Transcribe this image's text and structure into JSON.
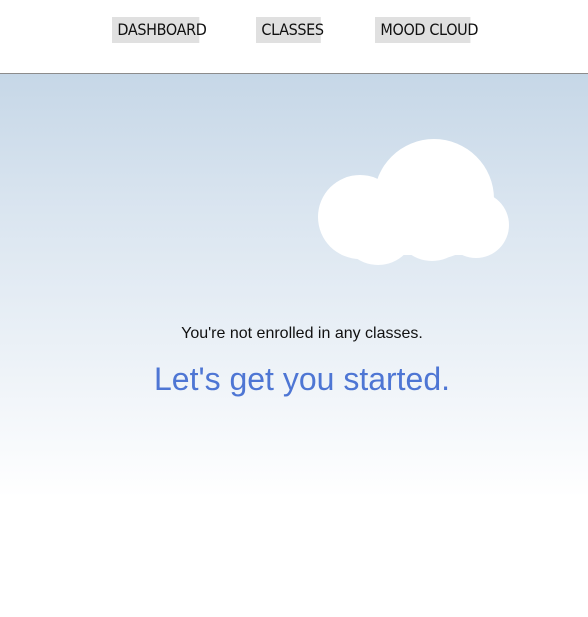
{
  "nav": {
    "items": [
      {
        "label": "DASHBOARD"
      },
      {
        "label": "CLASSES"
      },
      {
        "label": "MOOD CLOUD"
      }
    ]
  },
  "main": {
    "message": "You're not enrolled in any classes.",
    "cta": "Let's get you started."
  },
  "colors": {
    "accent": "#4e76d4",
    "nav_button_bg": "#e0e0e0",
    "sky_top": "#c6d7e7"
  },
  "icons": {
    "cloud": "cloud-icon"
  }
}
